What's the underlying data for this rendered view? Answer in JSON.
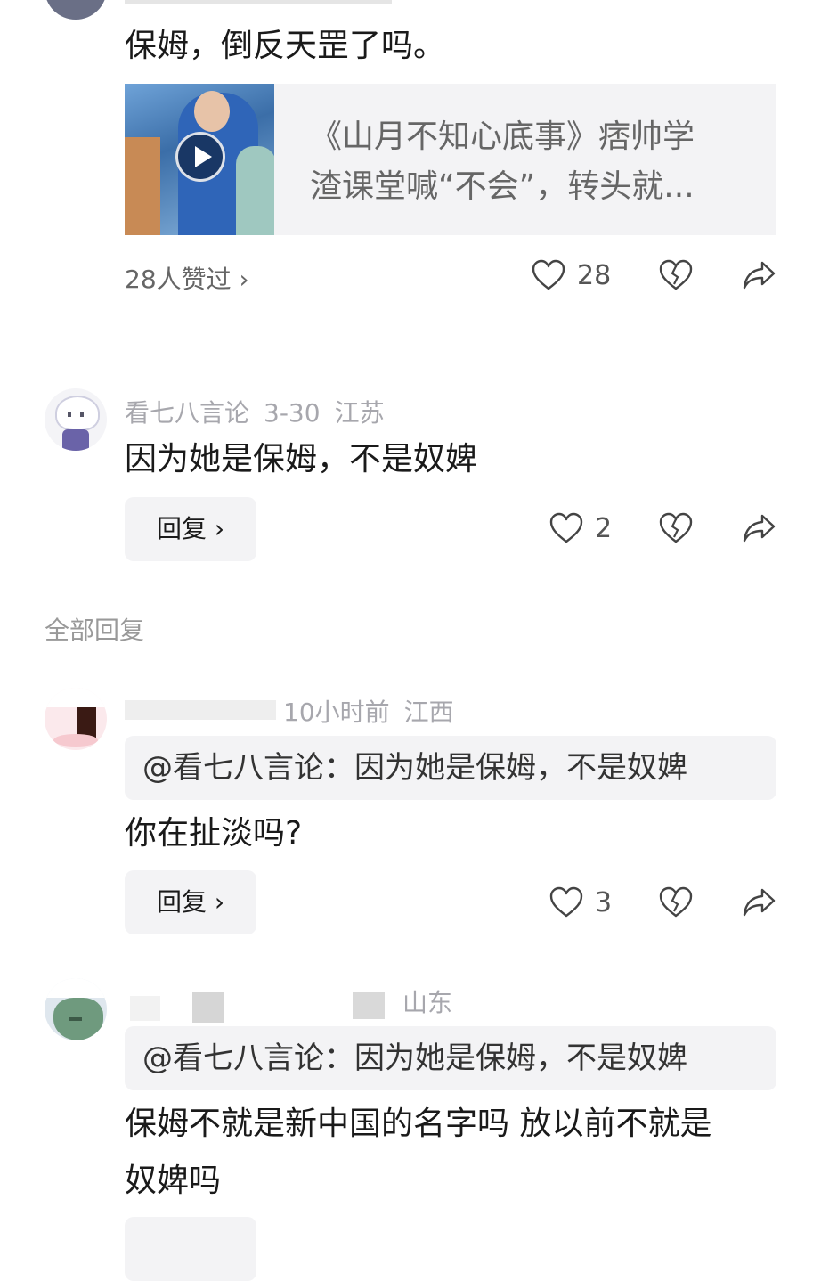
{
  "comment1": {
    "text": "保姆，倒反天罡了吗。",
    "video": {
      "title_line1": "《山月不知心底事》痞帅学",
      "title_line2": "渣课堂喊“不会”，转头就..."
    },
    "likes_link": "28人赞过 ›",
    "like_count": "28"
  },
  "comment2": {
    "username": "看七八言论",
    "date": "3-30",
    "location": "江苏",
    "text": "因为她是保姆，不是奴婢",
    "reply_label": "回复 ›",
    "like_count": "2"
  },
  "section_title": "全部回复",
  "reply1": {
    "time": "10小时前",
    "location": "江西",
    "quote": "@看七八言论：因为她是保姆，不是奴婢",
    "text": "你在扯淡吗?",
    "reply_label": "回复 ›",
    "like_count": "3"
  },
  "reply2": {
    "location": "山东",
    "quote": "@看七八言论：因为她是保姆，不是奴婢",
    "text_line1": "保姆不就是新中国的名字吗 放以前不就是",
    "text_line2": "奴婢吗"
  },
  "icons": {
    "like": "heart-outline-icon",
    "dislike": "broken-heart-icon",
    "share": "share-arrow-icon",
    "play": "play-icon"
  },
  "colors": {
    "muted": "#a7a7ad",
    "bubble": "#f3f3f5",
    "text": "#1a1a1a"
  }
}
